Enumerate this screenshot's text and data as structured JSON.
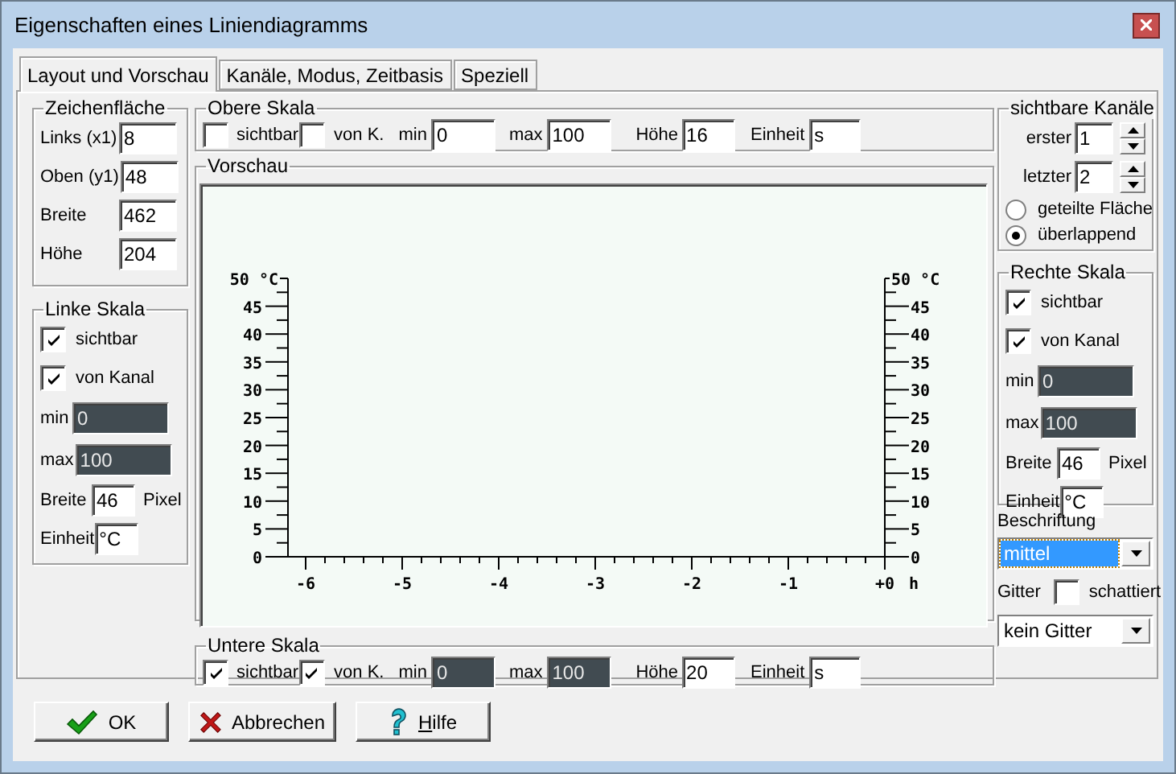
{
  "window": {
    "title": "Eigenschaften eines Liniendiagramms"
  },
  "tabs": [
    {
      "label": "Layout und Vorschau",
      "selected": true
    },
    {
      "label": "Kanäle, Modus, Zeitbasis",
      "selected": false
    },
    {
      "label": "Speziell",
      "selected": false
    }
  ],
  "drawing_area": {
    "title": "Zeichenfläche",
    "fields": [
      {
        "label": "Links (x1)",
        "value": "8"
      },
      {
        "label": "Oben (y1)",
        "value": "48"
      },
      {
        "label": "Breite",
        "value": "462"
      },
      {
        "label": "Höhe",
        "value": "204"
      }
    ]
  },
  "left_scale": {
    "title": "Linke Skala",
    "visible": {
      "label": "sichtbar",
      "checked": true
    },
    "from_channel": {
      "label": "von Kanal",
      "checked": true
    },
    "min": {
      "label": "min",
      "value": "0",
      "disabled": true
    },
    "max": {
      "label": "max",
      "value": "100",
      "disabled": true
    },
    "width": {
      "label": "Breite",
      "value": "46",
      "unit": "Pixel"
    },
    "unit": {
      "label": "Einheit",
      "value": "°C"
    }
  },
  "top_scale": {
    "title": "Obere Skala",
    "visible": {
      "label": "sichtbar",
      "checked": false
    },
    "from_channel": {
      "label": "von K.",
      "checked": false
    },
    "min": {
      "label": "min",
      "value": "0",
      "disabled": false
    },
    "max": {
      "label": "max",
      "value": "100",
      "disabled": false
    },
    "height": {
      "label": "Höhe",
      "value": "16"
    },
    "unit": {
      "label": "Einheit",
      "value": "s"
    }
  },
  "preview": {
    "title": "Vorschau",
    "left_labels": [
      "50 °C",
      "45",
      "40",
      "35",
      "30",
      "25",
      "20",
      "15",
      "10",
      "5",
      "0"
    ],
    "right_labels": [
      "50 °C",
      "45",
      "40",
      "35",
      "30",
      "25",
      "20",
      "15",
      "10",
      "5",
      "0"
    ],
    "bottom_labels": [
      "-6",
      "-5",
      "-4",
      "-3",
      "-2",
      "-1",
      "+0"
    ],
    "bottom_unit": "h"
  },
  "bottom_scale": {
    "title": "Untere Skala",
    "visible": {
      "label": "sichtbar",
      "checked": true
    },
    "from_channel": {
      "label": "von K.",
      "checked": true
    },
    "min": {
      "label": "min",
      "value": "0",
      "disabled": true
    },
    "max": {
      "label": "max",
      "value": "100",
      "disabled": true
    },
    "height": {
      "label": "Höhe",
      "value": "20"
    },
    "unit": {
      "label": "Einheit",
      "value": "s"
    }
  },
  "visible_channels": {
    "title": "sichtbare Kanäle",
    "first": {
      "label": "erster",
      "value": "1"
    },
    "last": {
      "label": "letzter",
      "value": "2"
    },
    "modes": [
      {
        "label": "geteilte Fläche",
        "selected": false
      },
      {
        "label": "überlappend",
        "selected": true
      }
    ]
  },
  "right_scale": {
    "title": "Rechte Skala",
    "visible": {
      "label": "sichtbar",
      "checked": true
    },
    "from_channel": {
      "label": "von Kanal",
      "checked": true
    },
    "min": {
      "label": "min",
      "value": "0",
      "disabled": true
    },
    "max": {
      "label": "max",
      "value": "100",
      "disabled": true
    },
    "width": {
      "label": "Breite",
      "value": "46",
      "unit": "Pixel"
    },
    "unit": {
      "label": "Einheit",
      "value": "°C"
    }
  },
  "labeling": {
    "label": "Beschriftung",
    "value": "mittel",
    "focused": true
  },
  "grid": {
    "label": "Gitter",
    "shaded": {
      "label": "schattiert",
      "checked": false
    },
    "value": "kein Gitter"
  },
  "buttons": [
    {
      "label": "OK",
      "kind": "ok"
    },
    {
      "label": "Abbrechen",
      "kind": "cancel"
    },
    {
      "label": "Hilfe",
      "kind": "help"
    }
  ]
}
